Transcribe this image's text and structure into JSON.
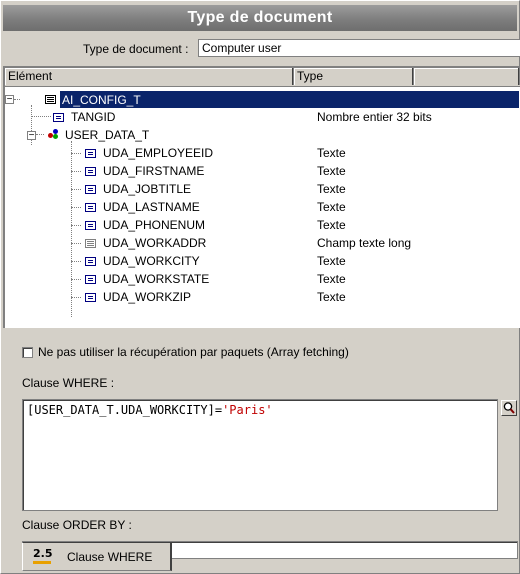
{
  "window": {
    "title": "Type de document"
  },
  "doc_type": {
    "label": "Type de document :",
    "value": "Computer user"
  },
  "tree": {
    "columns": [
      "Elément",
      "Type",
      ""
    ],
    "rows": [
      {
        "label": "AI_CONFIG_T",
        "type": "",
        "icon": "table-icon",
        "selected": true
      },
      {
        "label": "TANGID",
        "type": "Nombre entier 32 bits",
        "icon": "field-icon"
      },
      {
        "label": "USER_DATA_T",
        "type": "",
        "icon": "link-icon"
      },
      {
        "label": "UDA_EMPLOYEEID",
        "type": "Texte",
        "icon": "field-icon"
      },
      {
        "label": "UDA_FIRSTNAME",
        "type": "Texte",
        "icon": "field-icon"
      },
      {
        "label": "UDA_JOBTITLE",
        "type": "Texte",
        "icon": "field-icon"
      },
      {
        "label": "UDA_LASTNAME",
        "type": "Texte",
        "icon": "field-icon"
      },
      {
        "label": "UDA_PHONENUM",
        "type": "Texte",
        "icon": "field-icon"
      },
      {
        "label": "UDA_WORKADDR",
        "type": "Champ texte long",
        "icon": "memo-icon"
      },
      {
        "label": "UDA_WORKCITY",
        "type": "Texte",
        "icon": "field-icon"
      },
      {
        "label": "UDA_WORKSTATE",
        "type": "Texte",
        "icon": "field-icon"
      },
      {
        "label": "UDA_WORKZIP",
        "type": "Texte",
        "icon": "field-icon"
      }
    ]
  },
  "array_fetching": {
    "label": "Ne pas utiliser la récupération par paquets (Array fetching)",
    "checked": false
  },
  "where": {
    "label": "Clause WHERE :",
    "code_prefix": "[USER_DATA_T.UDA_WORKCITY]=",
    "code_string": "'Paris'"
  },
  "order_by": {
    "label": "Clause ORDER BY :",
    "value": ""
  },
  "tab": {
    "icon_text": "2.5",
    "label": "Clause WHERE"
  },
  "colors": {
    "selection": "#0a246a",
    "string_literal": "#c00000",
    "title_bar": "#7c7c7c"
  }
}
